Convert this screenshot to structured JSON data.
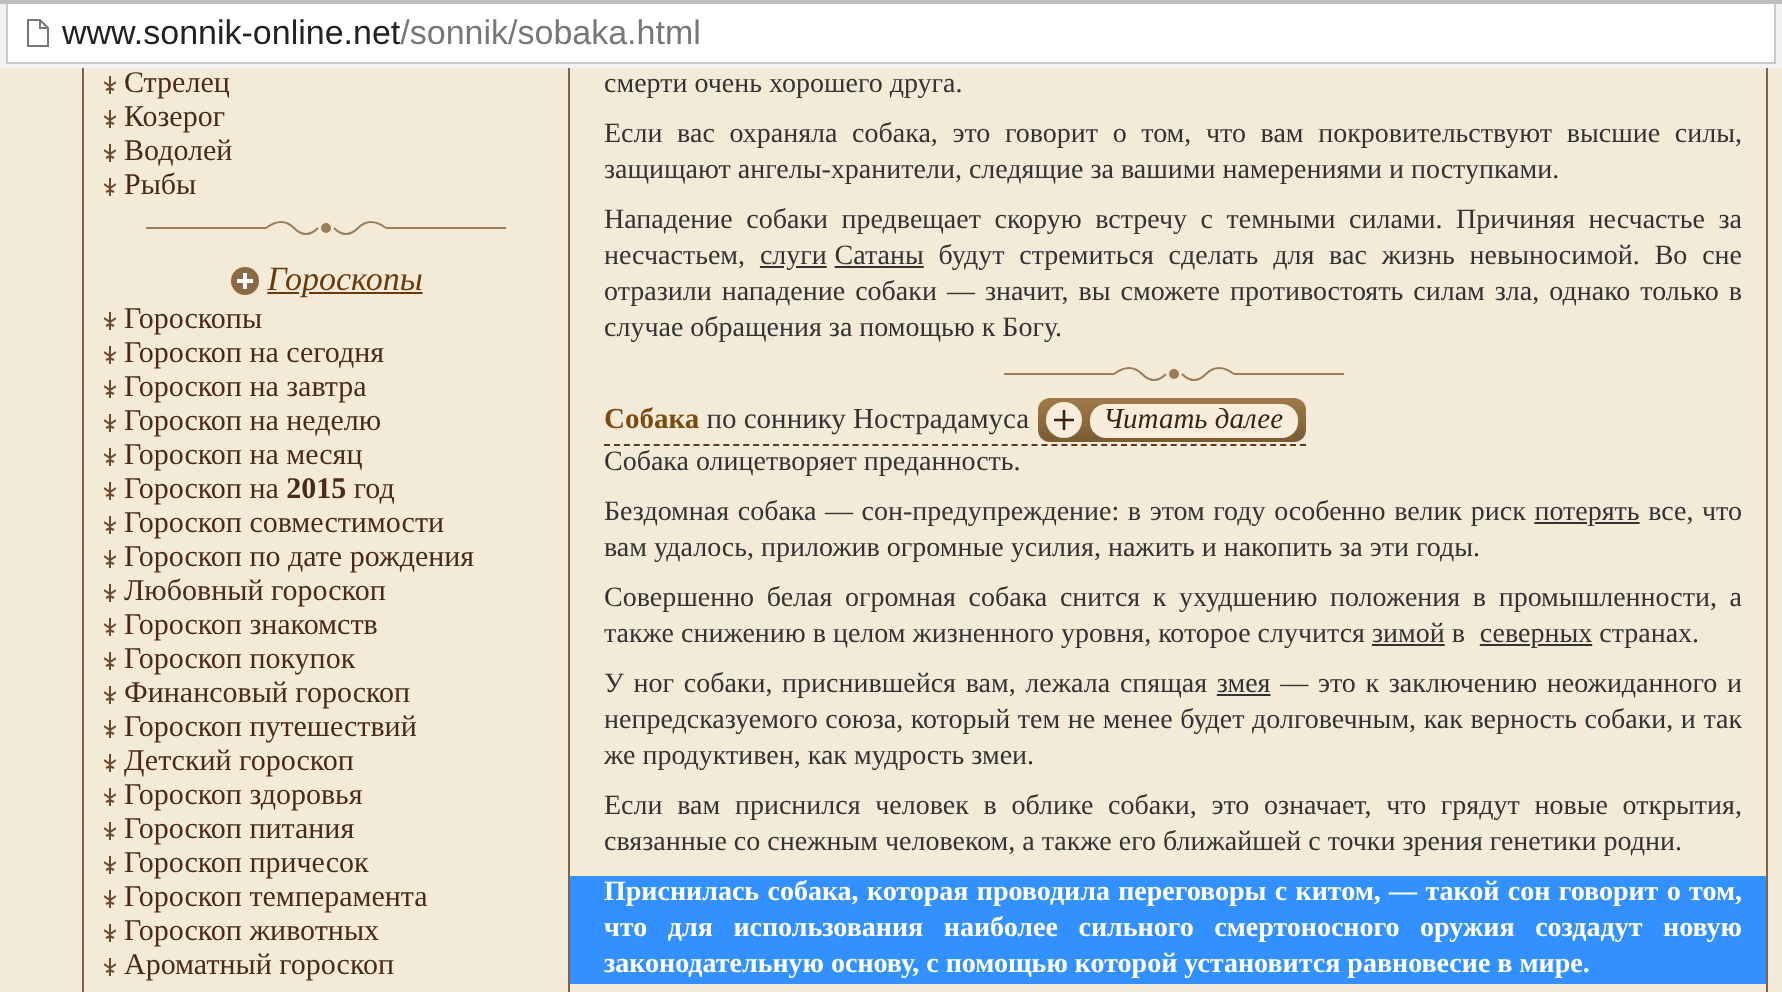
{
  "address_bar": {
    "host": "www.sonnik-online.net",
    "path": "/sonnik/sobaka.html"
  },
  "sidebar": {
    "items_top": [
      {
        "label": "Стрелец"
      },
      {
        "label": "Козерог"
      },
      {
        "label": "Водолей"
      },
      {
        "label": "Рыбы"
      }
    ],
    "section": {
      "title": "Гороскопы",
      "items": [
        {
          "label": "Гороскопы"
        },
        {
          "label": "Гороскоп на сегодня"
        },
        {
          "label": "Гороскоп на завтра"
        },
        {
          "label": "Гороскоп на неделю"
        },
        {
          "label": "Гороскоп на месяц"
        },
        {
          "label": "Гороскоп на **2015** год"
        },
        {
          "label": "Гороскоп совместимости"
        },
        {
          "label": "Гороскоп по дате рождения"
        },
        {
          "label": "Любовный гороскоп"
        },
        {
          "label": "Гороскоп знакомств"
        },
        {
          "label": "Гороскоп покупок"
        },
        {
          "label": "Финансовый гороскоп"
        },
        {
          "label": "Гороскоп путешествий"
        },
        {
          "label": "Детский гороскоп"
        },
        {
          "label": "Гороскоп здоровья"
        },
        {
          "label": "Гороскоп питания"
        },
        {
          "label": "Гороскоп причесок"
        },
        {
          "label": "Гороскоп темперамента"
        },
        {
          "label": "Гороскоп животных"
        },
        {
          "label": "Ароматный гороскоп"
        }
      ]
    }
  },
  "article": {
    "intro_paragraphs": [
      {
        "selected": false,
        "parts": [
          {
            "kind": "text",
            "text": "смерти очень хорошего друга."
          }
        ]
      },
      {
        "selected": false,
        "parts": [
          {
            "kind": "text",
            "text": "Если вас охраняла собака, это говорит о том, что вам покровительствуют высшие силы, защищают ангелы-хранители, следящие за вашими намерениями и поступками."
          }
        ]
      },
      {
        "selected": false,
        "parts": [
          {
            "kind": "text",
            "text": "Нападение собаки предвещает скорую встречу с темными силами. Причиняя несчастье за несчастьем, "
          },
          {
            "kind": "link",
            "text": "слуги"
          },
          {
            "kind": "link",
            "text": "Сатаны"
          },
          {
            "kind": "text",
            "text": " будут стремиться сделать для вас жизнь невыносимой. Во сне отразили нападение собаки — значит, вы сможете противостоять силам зла, однако только в случае обращения за помощью к Богу."
          }
        ]
      }
    ],
    "section": {
      "heading": "**Собака** по соннику Нострадамуса",
      "read_more": "Читать далее",
      "paragraphs": [
        {
          "selected": false,
          "parts": [
            {
              "kind": "text",
              "text": "Собака олицетворяет преданность."
            }
          ]
        },
        {
          "selected": false,
          "parts": [
            {
              "kind": "text",
              "text": "Бездомная собака — сон-предупреждение: в этом году особенно велик риск "
            },
            {
              "kind": "link",
              "text": "потерять"
            },
            {
              "kind": "text",
              "text": " все, что вам удалось, приложив огромные усилия, нажить и накопить за эти годы."
            }
          ]
        },
        {
          "selected": false,
          "parts": [
            {
              "kind": "text",
              "text": "Совершенно белая огромная собака снится к ухудшению положения в промышленности, а также снижению в целом жизненного уровня, которое случится "
            },
            {
              "kind": "link",
              "text": "зимой"
            },
            {
              "kind": "text",
              "text": " в "
            },
            {
              "kind": "link",
              "text": "северных"
            },
            {
              "kind": "text",
              "text": " странах."
            }
          ]
        },
        {
          "selected": false,
          "parts": [
            {
              "kind": "text",
              "text": "У ног собаки, приснившейся вам, лежала спящая "
            },
            {
              "kind": "link",
              "text": "змея"
            },
            {
              "kind": "text",
              "text": " — это к заключению неожиданного и непредсказуемого союза, который тем не менее будет долговечным, как верность собаки, и так же продуктивен, как мудрость змеи."
            }
          ]
        },
        {
          "selected": false,
          "parts": [
            {
              "kind": "text",
              "text": "Если вам приснился человек в облике собаки, это означает, что грядут новые открытия, связанные со снежным человеком, а также его ближайшей с точки зрения генетики родни."
            }
          ]
        },
        {
          "selected": true,
          "parts": [
            {
              "kind": "text",
              "text": "Приснилась собака, которая проводила переговоры с китом, — такой сон говорит о том, что для использования наиболее сильного смертоносного оружия создадут новую законодательную основу, с помощью которой установится равновесие в мире."
            }
          ]
        }
      ]
    }
  }
}
